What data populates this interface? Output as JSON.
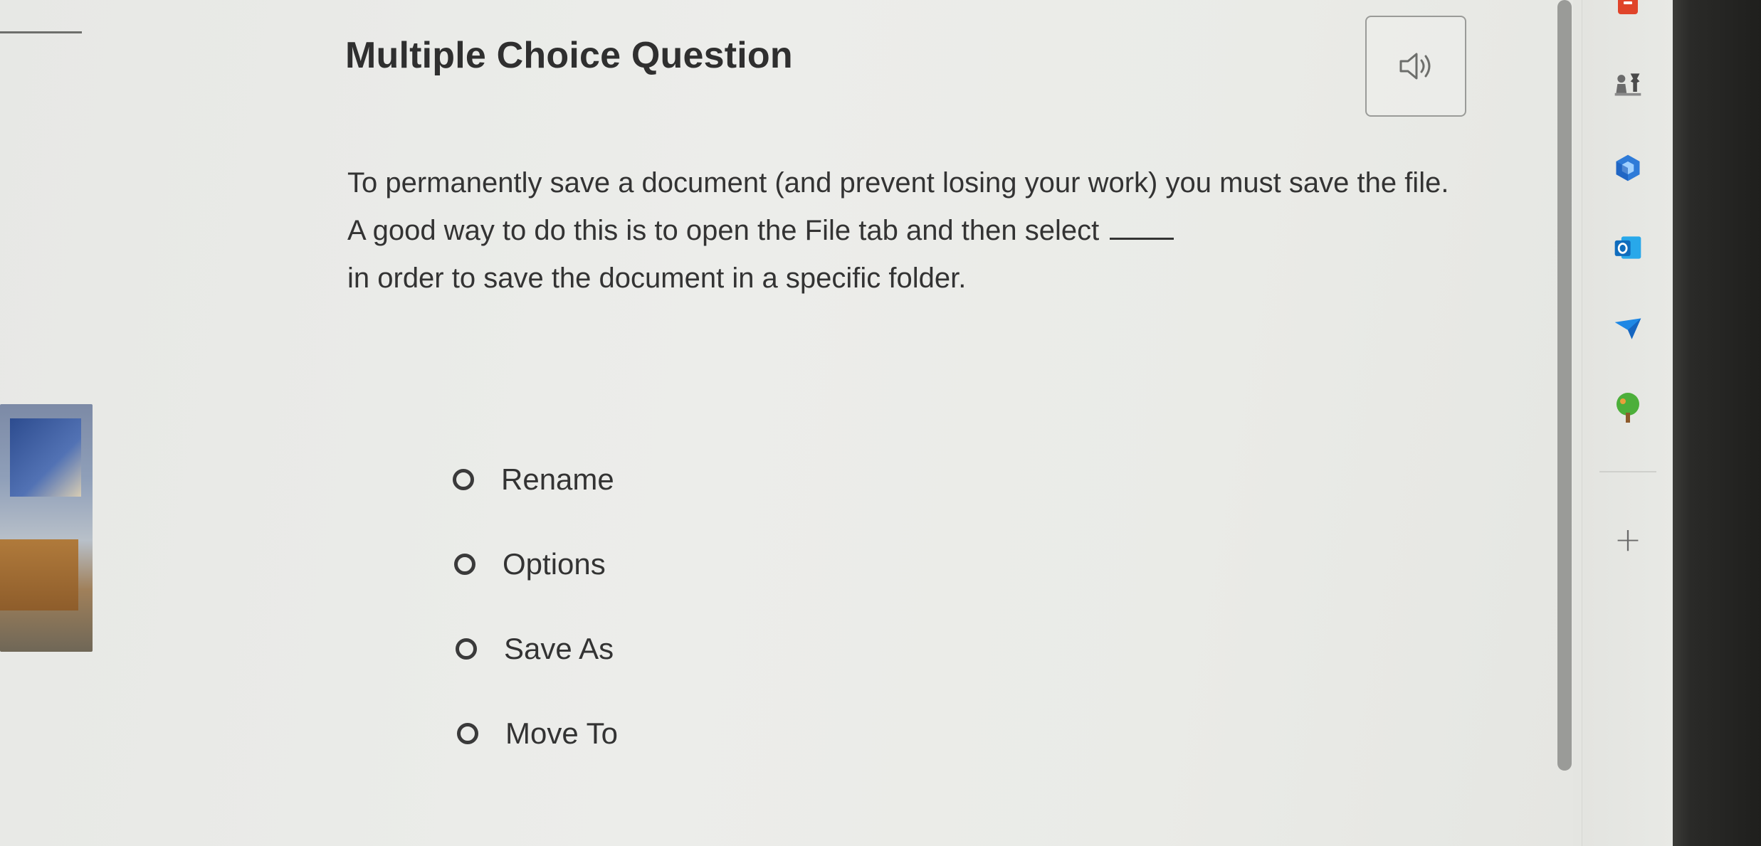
{
  "question": {
    "title": "Multiple Choice Question",
    "prompt_part1": "To permanently save a document (and prevent losing your work) you must save the file. A good way to do this is to open the File tab and then select",
    "prompt_part2": "in order to save the document in a specific folder.",
    "audio_button_icon": "speaker-icon"
  },
  "choices": [
    {
      "label": "Rename",
      "selected": false
    },
    {
      "label": "Options",
      "selected": false
    },
    {
      "label": "Save As",
      "selected": false
    },
    {
      "label": "Move To",
      "selected": false
    }
  ],
  "sidebar": {
    "items": [
      {
        "icon": "shopping-bag-icon",
        "color": "#e0442a"
      },
      {
        "icon": "chess-icon",
        "color": "#6b6b6b"
      },
      {
        "icon": "copilot-icon",
        "color": "#2e7bd8"
      },
      {
        "icon": "outlook-icon",
        "color": "#0f6cbd"
      },
      {
        "icon": "send-icon",
        "color": "#1e88e5"
      },
      {
        "icon": "tree-icon",
        "color": "#4caf3a"
      }
    ],
    "add_label": "+"
  }
}
